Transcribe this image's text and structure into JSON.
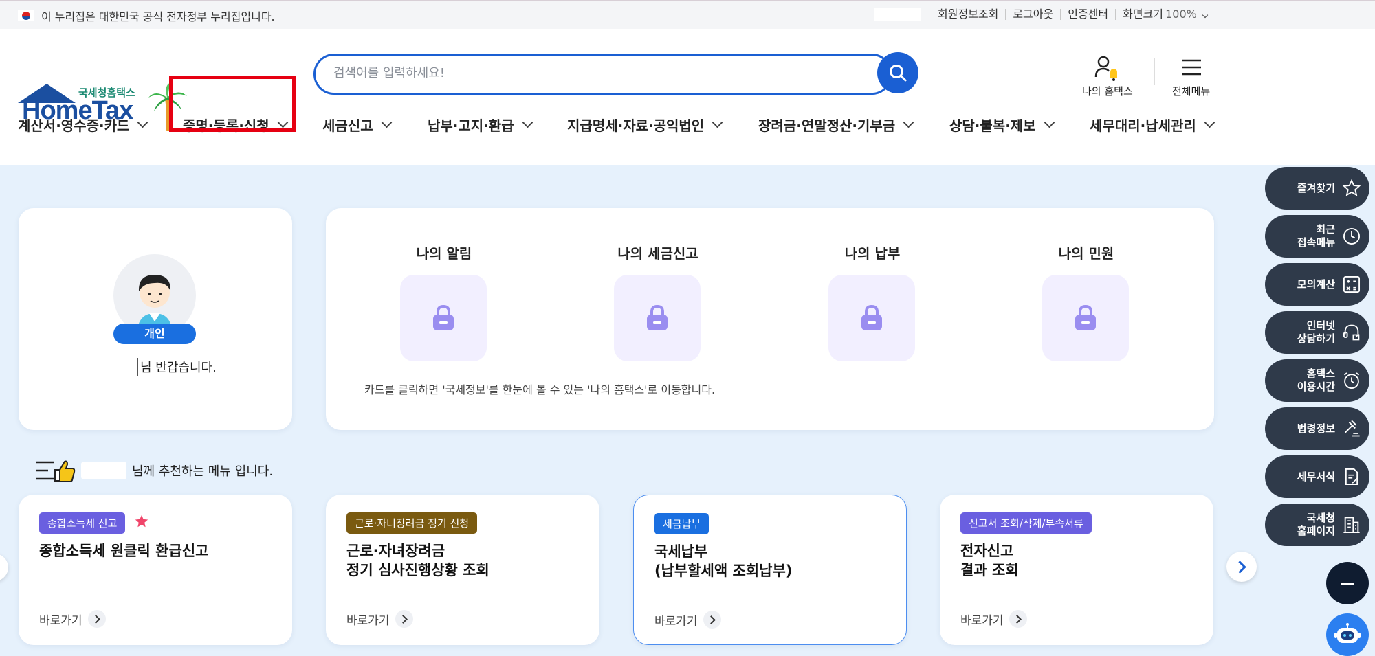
{
  "topbar": {
    "notice": "이 누리집은 대한민국 공식 전자정부 누리집입니다.",
    "links": [
      "회원정보조회",
      "로그아웃",
      "인증센터"
    ],
    "zoom_label": "화면크기",
    "zoom_value": "100%"
  },
  "header": {
    "logo_sub": "국세청홈택스",
    "logo_main": "HomeTax",
    "search_placeholder": "검색어를 입력하세요!",
    "my_hometax": "나의 홈택스",
    "all_menu": "전체메뉴"
  },
  "nav": {
    "items": [
      {
        "label": "계산서·영수증·카드"
      },
      {
        "label": "증명·등록·신청"
      },
      {
        "label": "세금신고"
      },
      {
        "label": "납부·고지·환급"
      },
      {
        "label": "지급명세·자료·공익법인"
      },
      {
        "label": "장려금·연말정산·기부금"
      },
      {
        "label": "상담·불복·제보"
      },
      {
        "label": "세무대리·납세관리"
      }
    ],
    "highlighted_index": 1
  },
  "profile": {
    "type": "개인",
    "greeting": "님 반갑습니다."
  },
  "my_home": {
    "items": [
      "나의 알림",
      "나의 세금신고",
      "나의 납부",
      "나의 민원"
    ],
    "note": "카드를 클릭하면 '국세정보'를 한눈에 볼 수 있는 '나의 홈택스'로 이동합니다."
  },
  "recommend": {
    "heading": "님께 추천하는 메뉴 입니다.",
    "cards": [
      {
        "badge": "종합소득세 신고",
        "badge_color": "#6a5fe0",
        "title": "종합소득세 원클릭 환급신고",
        "link": "바로가기",
        "starred": true
      },
      {
        "badge": "근로·자녀장려금 정기 신청",
        "badge_color": "#7a5a10",
        "title": "근로·자녀장려금\n정기 심사진행상황 조회",
        "link": "바로가기"
      },
      {
        "badge": "세금납부",
        "badge_color": "#1a6fe0",
        "title": "국세납부\n(납부할세액 조회납부)",
        "link": "바로가기"
      },
      {
        "badge": "신고서 조회/삭제/부속서류",
        "badge_color": "#6a5fe0",
        "title": "전자신고\n결과 조회",
        "link": "바로가기"
      }
    ]
  },
  "quick_menu": [
    {
      "label": "즐겨찾기",
      "icon": "star-icon"
    },
    {
      "label": "최근\n접속메뉴",
      "icon": "clock-icon"
    },
    {
      "label": "모의계산",
      "icon": "calculator-icon"
    },
    {
      "label": "인터넷\n상담하기",
      "icon": "headset-icon"
    },
    {
      "label": "홈택스\n이용시간",
      "icon": "alarm-icon"
    },
    {
      "label": "법령정보",
      "icon": "gavel-icon"
    },
    {
      "label": "세무서식",
      "icon": "document-icon"
    },
    {
      "label": "국세청\n홈페이지",
      "icon": "building-icon"
    }
  ],
  "colors": {
    "accent": "#1a5fd3",
    "highlight_box": "#e60012",
    "quick_bg": "#2f3a4a",
    "background": "#e6f1fc"
  }
}
